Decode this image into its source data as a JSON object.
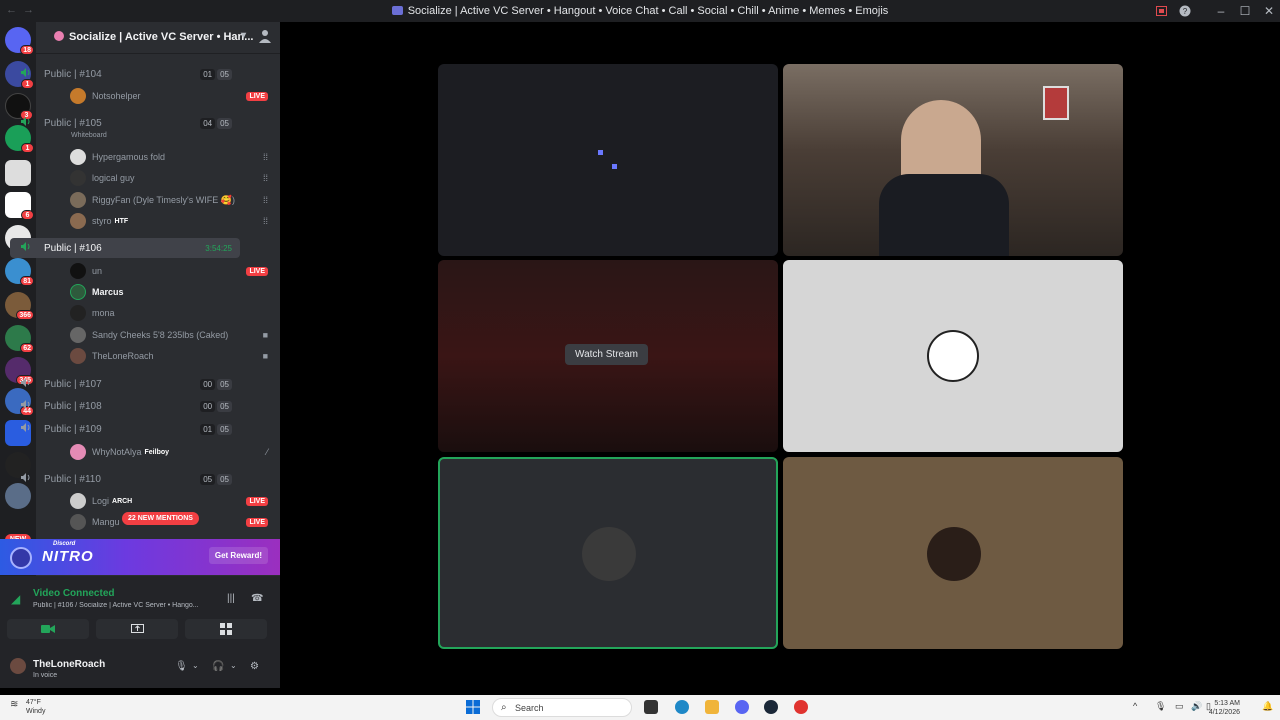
{
  "window": {
    "title": "Socialize | Active VC Server • Hangout • Voice Chat • Call • Social • Chill • Anime • Memes • Emojis",
    "controls": [
      "minimize",
      "maximize",
      "close"
    ]
  },
  "guild_badges": [
    "18",
    "1",
    "3",
    "1",
    "6",
    "81",
    "366",
    "62",
    "345",
    "44"
  ],
  "guild_new_label": "NEW",
  "server": {
    "name": "Socialize | Active VC Server • Han..."
  },
  "channels": [
    {
      "name": "Public | #104",
      "count_a": "01",
      "count_b": "05"
    },
    {
      "name": "Public | #105",
      "sub": "Whiteboard",
      "count_a": "04",
      "count_b": "05"
    },
    {
      "name": "Public | #106",
      "timer": "3:54:25"
    },
    {
      "name": "Public | #107",
      "count_a": "00",
      "count_b": "05"
    },
    {
      "name": "Public | #108",
      "count_a": "00",
      "count_b": "05"
    },
    {
      "name": "Public | #109",
      "count_a": "01",
      "count_b": "05"
    },
    {
      "name": "Public | #110",
      "count_a": "05",
      "count_b": "05"
    }
  ],
  "members": {
    "c104": [
      {
        "name": "Notsohelper",
        "status": "LIVE"
      }
    ],
    "c105": [
      {
        "name": "Hypergamous fold"
      },
      {
        "name": "logical guy"
      },
      {
        "name": "RiggyFan (Dyle Timesly's WIFE 🥰)"
      },
      {
        "name": "styro",
        "tag": "HTF"
      }
    ],
    "c106": [
      {
        "name": "un",
        "status": "LIVE"
      },
      {
        "name": "Marcus"
      },
      {
        "name": "mona"
      },
      {
        "name": "Sandy Cheeks 5'8 235lbs (Caked)"
      },
      {
        "name": "TheLoneRoach"
      }
    ],
    "c109": [
      {
        "name": "WhyNotAlya",
        "tag": "Feilboy"
      }
    ],
    "c110": [
      {
        "name": "Logi",
        "tag": "ARCH",
        "status": "LIVE"
      },
      {
        "name": "Mangu",
        "status": "LIVE"
      }
    ]
  },
  "mentions_label": "22 NEW MENTIONS",
  "nitro": {
    "brand_small": "Discord",
    "brand": "NITRO",
    "cta": "Get Reward!"
  },
  "voice": {
    "status": "Video Connected",
    "subtitle": "Public | #106 / Socialize | Active VC Server • Hango..."
  },
  "user": {
    "name": "TheLoneRoach",
    "status": "In voice"
  },
  "stage": {
    "watch_label": "Watch Stream"
  },
  "taskbar": {
    "weather_temp": "47°F",
    "weather_desc": "Windy",
    "search_placeholder": "Search",
    "time": "5:13 AM",
    "date": "4/12/2026"
  },
  "colors": {
    "accent_green": "#23a55a",
    "live_red": "#f23f43",
    "sidebar": "#2b2d31",
    "rail": "#1e1f22"
  }
}
